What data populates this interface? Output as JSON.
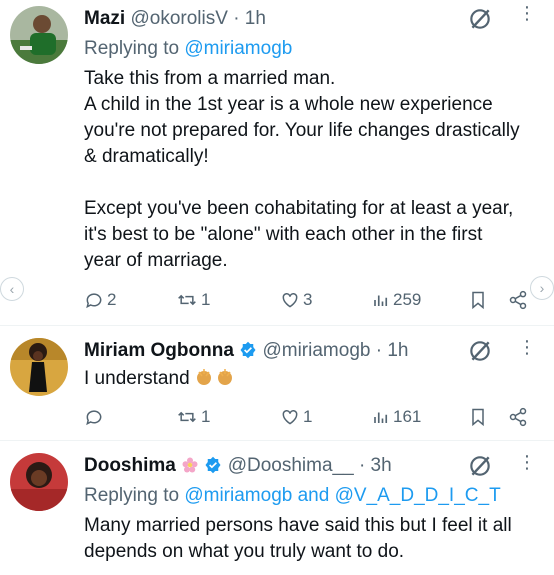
{
  "tweets": [
    {
      "name": "Mazi",
      "handle": "@okorolisV",
      "time": "· 1h",
      "replying_prefix": "Replying to",
      "replying_to": "@miriamogb",
      "replying_to_2": "",
      "replying_join": "",
      "lines": [
        "Take this from a married man.",
        "A child in the 1st year is a whole new experience",
        "you're not prepared for. Your life changes drastically",
        "& dramatically!",
        "",
        "Except you've been cohabitating for at least a year,",
        "it's best to be \"alone\" with each other in the first",
        "year of marriage."
      ],
      "replies": "2",
      "retweets": "1",
      "likes": "3",
      "views": "259"
    },
    {
      "name": "Miriam Ogbonna",
      "handle": "@miriamogb",
      "time": "· 1h",
      "verified": true,
      "text": "I understand",
      "replies": "",
      "retweets": "1",
      "likes": "1",
      "views": "161"
    },
    {
      "name": "Dooshima",
      "handle": "@Dooshima__",
      "time": "· 3h",
      "verified": true,
      "replying_prefix": "Replying to",
      "replying_to": "@miriamogb",
      "replying_join": "and",
      "replying_to_2": "@V_A_D_D_I_C_T",
      "lines": [
        "Many married persons have said this but I feel it all",
        "depends on what you truly want to do."
      ]
    }
  ],
  "colors": {
    "link": "#1d9bf0",
    "secondary": "#536471",
    "verified": "#1d9bf0"
  },
  "icons": [
    "grok-icon",
    "more-icon",
    "reply-icon",
    "retweet-icon",
    "like-icon",
    "views-icon",
    "bookmark-icon",
    "share-icon",
    "chevron-left-icon",
    "chevron-right-icon",
    "verified-icon",
    "clap-emoji-icon",
    "flower-emoji-icon"
  ]
}
